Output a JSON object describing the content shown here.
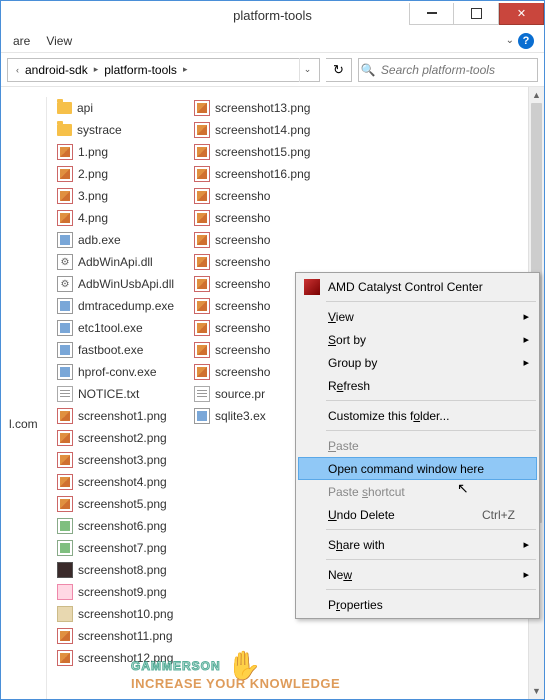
{
  "title": "platform-tools",
  "menubar": {
    "items": [
      "are",
      "View"
    ]
  },
  "breadcrumb": {
    "segments": [
      "android-sdk",
      "platform-tools"
    ]
  },
  "search": {
    "placeholder": "Search platform-tools"
  },
  "left_fragment": "l.com",
  "columns": [
    [
      {
        "name": "api",
        "icon": "folder"
      },
      {
        "name": "systrace",
        "icon": "folder"
      },
      {
        "name": "1.png",
        "icon": "img"
      },
      {
        "name": "2.png",
        "icon": "img"
      },
      {
        "name": "3.png",
        "icon": "img"
      },
      {
        "name": "4.png",
        "icon": "img"
      },
      {
        "name": "adb.exe",
        "icon": "exe"
      },
      {
        "name": "AdbWinApi.dll",
        "icon": "dll"
      },
      {
        "name": "AdbWinUsbApi.dll",
        "icon": "dll"
      },
      {
        "name": "dmtracedump.exe",
        "icon": "exe"
      },
      {
        "name": "etc1tool.exe",
        "icon": "exe"
      },
      {
        "name": "fastboot.exe",
        "icon": "exe"
      },
      {
        "name": "hprof-conv.exe",
        "icon": "exe"
      },
      {
        "name": "NOTICE.txt",
        "icon": "txt"
      },
      {
        "name": "screenshot1.png",
        "icon": "img"
      },
      {
        "name": "screenshot2.png",
        "icon": "img"
      },
      {
        "name": "screenshot3.png",
        "icon": "img"
      },
      {
        "name": "screenshot4.png",
        "icon": "img"
      },
      {
        "name": "screenshot5.png",
        "icon": "img"
      },
      {
        "name": "screenshot6.png",
        "icon": "img2"
      },
      {
        "name": "screenshot7.png",
        "icon": "img2"
      },
      {
        "name": "screenshot8.png",
        "icon": "dark"
      },
      {
        "name": "screenshot9.png",
        "icon": "pink"
      },
      {
        "name": "screenshot10.png",
        "icon": "tan"
      },
      {
        "name": "screenshot11.png",
        "icon": "img"
      },
      {
        "name": "screenshot12.png",
        "icon": "img"
      }
    ],
    [
      {
        "name": "screenshot13.png",
        "icon": "img"
      },
      {
        "name": "screenshot14.png",
        "icon": "img"
      },
      {
        "name": "screenshot15.png",
        "icon": "img"
      },
      {
        "name": "screenshot16.png",
        "icon": "img"
      },
      {
        "name": "screensho",
        "icon": "img"
      },
      {
        "name": "screensho",
        "icon": "img"
      },
      {
        "name": "screensho",
        "icon": "img"
      },
      {
        "name": "screensho",
        "icon": "img"
      },
      {
        "name": "screensho",
        "icon": "img"
      },
      {
        "name": "screensho",
        "icon": "img"
      },
      {
        "name": "screensho",
        "icon": "img"
      },
      {
        "name": "screensho",
        "icon": "img"
      },
      {
        "name": "screensho",
        "icon": "img"
      },
      {
        "name": "source.pr",
        "icon": "txt"
      },
      {
        "name": "sqlite3.ex",
        "icon": "exe"
      }
    ]
  ],
  "context_menu": {
    "items": [
      {
        "label": "AMD Catalyst Control Center",
        "icon": "amd"
      },
      {
        "type": "sep"
      },
      {
        "label": "View",
        "ul": 0,
        "sub": true
      },
      {
        "label": "Sort by",
        "ul": 0,
        "sub": true
      },
      {
        "label": "Group by",
        "sub": true
      },
      {
        "label": "Refresh",
        "ul": 1
      },
      {
        "type": "sep"
      },
      {
        "label": "Customize this folder...",
        "ul": 16
      },
      {
        "type": "sep"
      },
      {
        "label": "Paste",
        "ul": 0,
        "disabled": true
      },
      {
        "label": "Open command window here",
        "highlight": true
      },
      {
        "label": "Paste shortcut",
        "ul": 6,
        "disabled": true
      },
      {
        "label": "Undo Delete",
        "ul": 0,
        "shortcut": "Ctrl+Z"
      },
      {
        "type": "sep"
      },
      {
        "label": "Share with",
        "ul": 1,
        "sub": true
      },
      {
        "type": "sep"
      },
      {
        "label": "New",
        "ul": 2,
        "sub": true
      },
      {
        "type": "sep"
      },
      {
        "label": "Properties",
        "ul": 1
      }
    ]
  },
  "watermark": {
    "brand": "GAMMERSON",
    "tagline": "INCREASE YOUR KNOWLEDGE"
  }
}
